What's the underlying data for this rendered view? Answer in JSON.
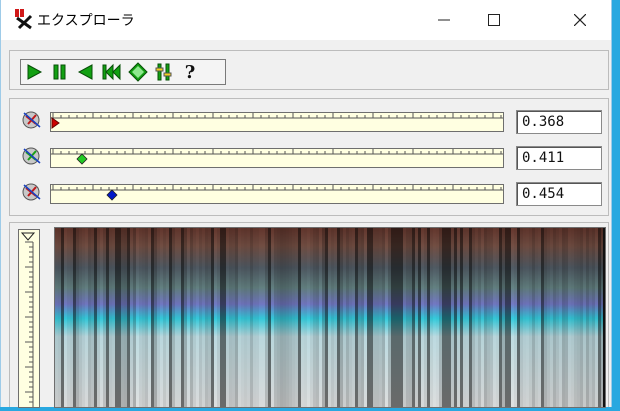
{
  "window": {
    "title": "エクスプローラ",
    "controls": {
      "minimize": "—",
      "maximize": "☐",
      "close": "✕"
    }
  },
  "toolbar": {
    "buttons": [
      {
        "name": "play",
        "icon": "play-icon"
      },
      {
        "name": "pause",
        "icon": "pause-icon"
      },
      {
        "name": "step-back",
        "icon": "step-back-icon"
      },
      {
        "name": "rewind",
        "icon": "rewind-icon"
      },
      {
        "name": "diamond",
        "icon": "diamond-icon"
      },
      {
        "name": "settings",
        "icon": "settings-icon"
      },
      {
        "name": "help",
        "icon": "help-icon",
        "label": "?"
      }
    ],
    "accent": "#12a012"
  },
  "sliders": [
    {
      "value_text": "0.368",
      "marker": "triangle",
      "marker_color": "#cc0000",
      "position": 0.0
    },
    {
      "value_text": "0.411",
      "marker": "diamond",
      "marker_color": "#22cc22",
      "position": 0.06
    },
    {
      "value_text": "0.454",
      "marker": "diamond",
      "marker_color": "#0018c8",
      "position": 0.125
    }
  ]
}
